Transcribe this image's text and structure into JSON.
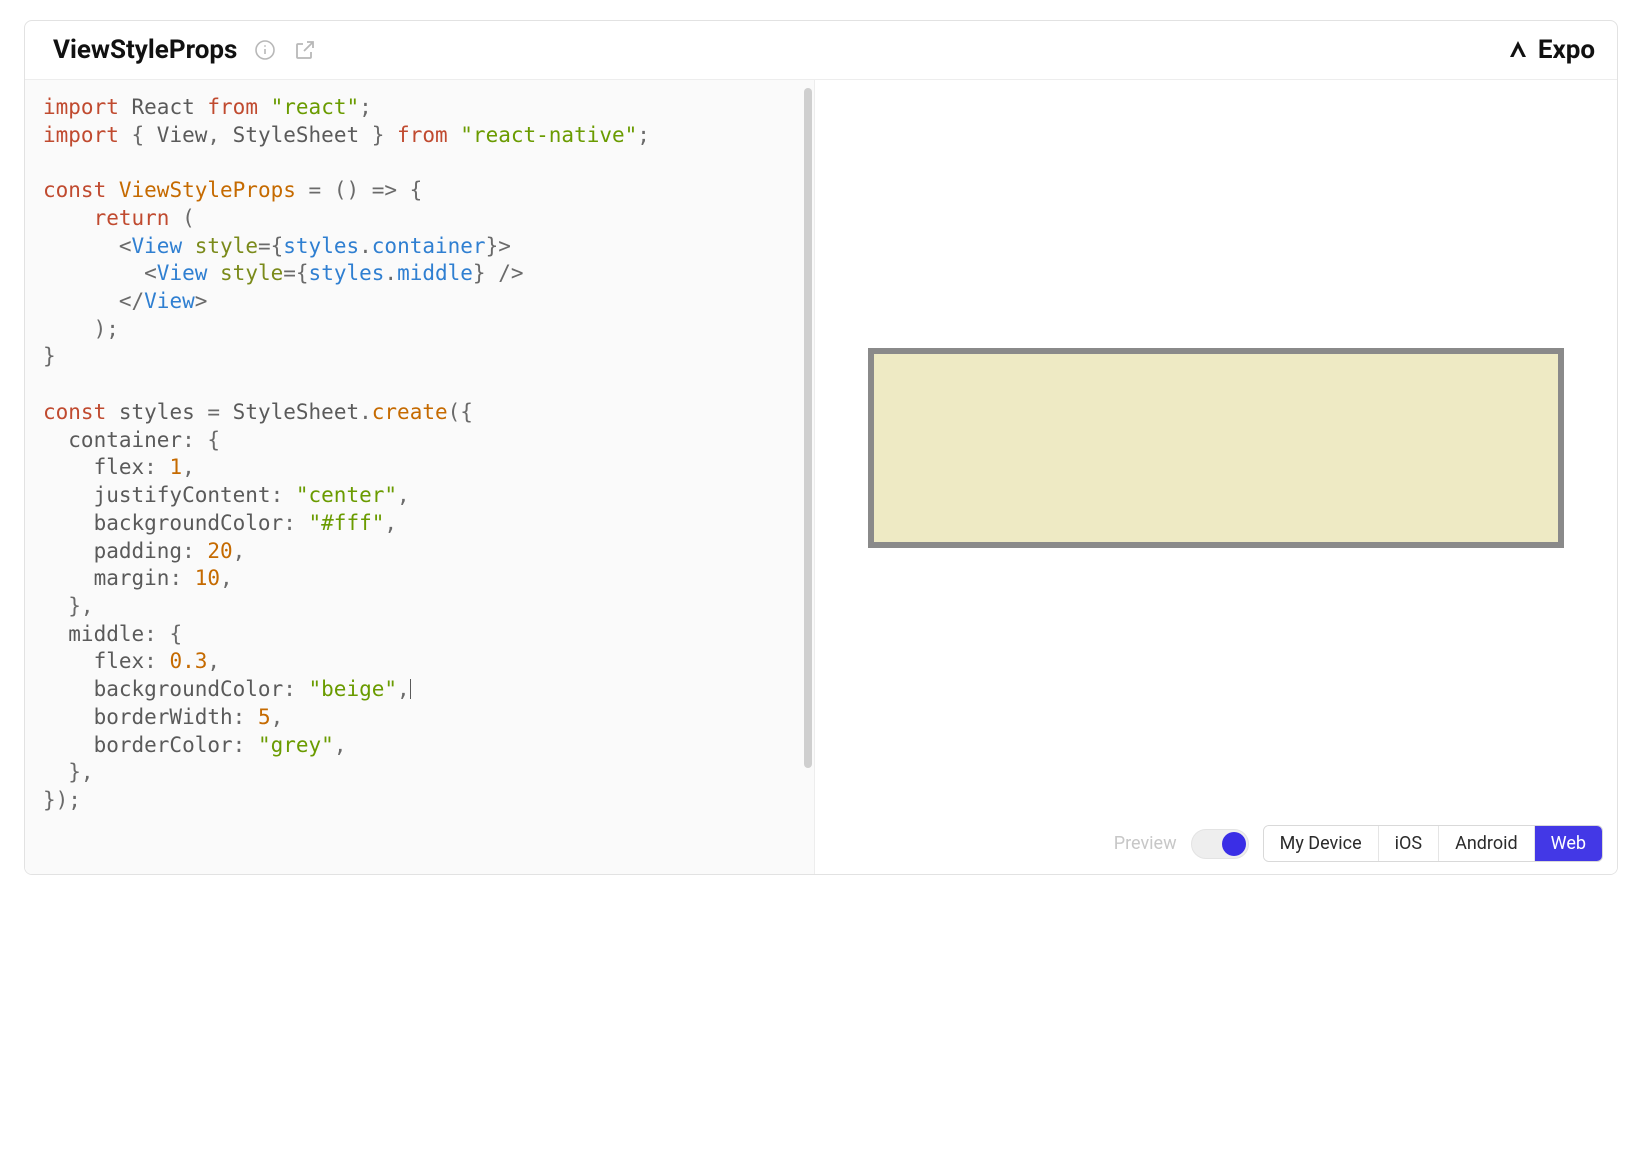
{
  "header": {
    "title": "ViewStyleProps",
    "expo_label": "Expo"
  },
  "code": {
    "lines": [
      {
        "spans": [
          {
            "t": "import",
            "c": "kw"
          },
          {
            "t": " "
          },
          {
            "t": "React",
            "c": "id"
          },
          {
            "t": " "
          },
          {
            "t": "from",
            "c": "kw"
          },
          {
            "t": " "
          },
          {
            "t": "\"react\"",
            "c": "str"
          },
          {
            "t": ";",
            "c": "punc"
          }
        ]
      },
      {
        "spans": [
          {
            "t": "import",
            "c": "kw"
          },
          {
            "t": " { "
          },
          {
            "t": "View",
            "c": "id"
          },
          {
            "t": ", "
          },
          {
            "t": "StyleSheet",
            "c": "id"
          },
          {
            "t": " } "
          },
          {
            "t": "from",
            "c": "kw"
          },
          {
            "t": " "
          },
          {
            "t": "\"react-native\"",
            "c": "str"
          },
          {
            "t": ";",
            "c": "punc"
          }
        ]
      },
      {
        "spans": [
          {
            "t": " "
          }
        ]
      },
      {
        "spans": [
          {
            "t": "const",
            "c": "kw"
          },
          {
            "t": " "
          },
          {
            "t": "ViewStyleProps",
            "c": "call"
          },
          {
            "t": " = () => {",
            "c": "punc"
          }
        ]
      },
      {
        "spans": [
          {
            "t": "    "
          },
          {
            "t": "return",
            "c": "kw"
          },
          {
            "t": " (",
            "c": "punc"
          }
        ]
      },
      {
        "spans": [
          {
            "t": "      <",
            "c": "punc"
          },
          {
            "t": "View",
            "c": "tag"
          },
          {
            "t": " "
          },
          {
            "t": "style",
            "c": "attr"
          },
          {
            "t": "={",
            "c": "punc"
          },
          {
            "t": "styles",
            "c": "mem"
          },
          {
            "t": ".",
            "c": "punc"
          },
          {
            "t": "container",
            "c": "mem"
          },
          {
            "t": "}>",
            "c": "punc"
          }
        ]
      },
      {
        "spans": [
          {
            "t": "        <",
            "c": "punc"
          },
          {
            "t": "View",
            "c": "tag"
          },
          {
            "t": " "
          },
          {
            "t": "style",
            "c": "attr"
          },
          {
            "t": "={",
            "c": "punc"
          },
          {
            "t": "styles",
            "c": "mem"
          },
          {
            "t": ".",
            "c": "punc"
          },
          {
            "t": "middle",
            "c": "mem"
          },
          {
            "t": "} />",
            "c": "punc"
          }
        ]
      },
      {
        "spans": [
          {
            "t": "      </",
            "c": "punc"
          },
          {
            "t": "View",
            "c": "tag"
          },
          {
            "t": ">",
            "c": "punc"
          }
        ]
      },
      {
        "spans": [
          {
            "t": "    );",
            "c": "punc"
          }
        ]
      },
      {
        "spans": [
          {
            "t": "}",
            "c": "punc"
          }
        ]
      },
      {
        "spans": [
          {
            "t": " "
          }
        ]
      },
      {
        "spans": [
          {
            "t": "const",
            "c": "kw"
          },
          {
            "t": " "
          },
          {
            "t": "styles",
            "c": "id"
          },
          {
            "t": " = "
          },
          {
            "t": "StyleSheet",
            "c": "id"
          },
          {
            "t": ".",
            "c": "punc"
          },
          {
            "t": "create",
            "c": "call"
          },
          {
            "t": "({",
            "c": "punc"
          }
        ]
      },
      {
        "spans": [
          {
            "t": "  container",
            "c": "prop"
          },
          {
            "t": ": {",
            "c": "punc"
          }
        ]
      },
      {
        "spans": [
          {
            "t": "    flex",
            "c": "prop"
          },
          {
            "t": ": ",
            "c": "punc"
          },
          {
            "t": "1",
            "c": "num"
          },
          {
            "t": ",",
            "c": "punc"
          }
        ]
      },
      {
        "spans": [
          {
            "t": "    justifyContent",
            "c": "prop"
          },
          {
            "t": ": ",
            "c": "punc"
          },
          {
            "t": "\"center\"",
            "c": "str"
          },
          {
            "t": ",",
            "c": "punc"
          }
        ]
      },
      {
        "spans": [
          {
            "t": "    backgroundColor",
            "c": "prop"
          },
          {
            "t": ": ",
            "c": "punc"
          },
          {
            "t": "\"#fff\"",
            "c": "str"
          },
          {
            "t": ",",
            "c": "punc"
          }
        ]
      },
      {
        "spans": [
          {
            "t": "    padding",
            "c": "prop"
          },
          {
            "t": ": ",
            "c": "punc"
          },
          {
            "t": "20",
            "c": "num"
          },
          {
            "t": ",",
            "c": "punc"
          }
        ]
      },
      {
        "spans": [
          {
            "t": "    margin",
            "c": "prop"
          },
          {
            "t": ": ",
            "c": "punc"
          },
          {
            "t": "10",
            "c": "num"
          },
          {
            "t": ",",
            "c": "punc"
          }
        ]
      },
      {
        "spans": [
          {
            "t": "  },",
            "c": "punc"
          }
        ]
      },
      {
        "spans": [
          {
            "t": "  middle",
            "c": "prop"
          },
          {
            "t": ": {",
            "c": "punc"
          }
        ]
      },
      {
        "spans": [
          {
            "t": "    flex",
            "c": "prop"
          },
          {
            "t": ": ",
            "c": "punc"
          },
          {
            "t": "0.3",
            "c": "num"
          },
          {
            "t": ",",
            "c": "punc"
          }
        ]
      },
      {
        "spans": [
          {
            "t": "    backgroundColor",
            "c": "prop"
          },
          {
            "t": ": ",
            "c": "punc"
          },
          {
            "t": "\"beige\"",
            "c": "str"
          },
          {
            "t": ",",
            "c": "punc"
          },
          {
            "caret": true
          }
        ]
      },
      {
        "spans": [
          {
            "t": "    borderWidth",
            "c": "prop"
          },
          {
            "t": ": ",
            "c": "punc"
          },
          {
            "t": "5",
            "c": "num"
          },
          {
            "t": ",",
            "c": "punc"
          }
        ]
      },
      {
        "spans": [
          {
            "t": "    borderColor",
            "c": "prop"
          },
          {
            "t": ": ",
            "c": "punc"
          },
          {
            "t": "\"grey\"",
            "c": "str"
          },
          {
            "t": ",",
            "c": "punc"
          }
        ]
      },
      {
        "spans": [
          {
            "t": "  },",
            "c": "punc"
          }
        ]
      },
      {
        "spans": [
          {
            "t": "});",
            "c": "punc"
          }
        ]
      }
    ]
  },
  "preview": {
    "inner_bg": "#eeeac4",
    "border_color": "#8a8a8a"
  },
  "footer": {
    "preview_label": "Preview",
    "toggle_on": true,
    "segments": [
      {
        "label": "My Device",
        "active": false
      },
      {
        "label": "iOS",
        "active": false
      },
      {
        "label": "Android",
        "active": false
      },
      {
        "label": "Web",
        "active": true
      }
    ]
  }
}
